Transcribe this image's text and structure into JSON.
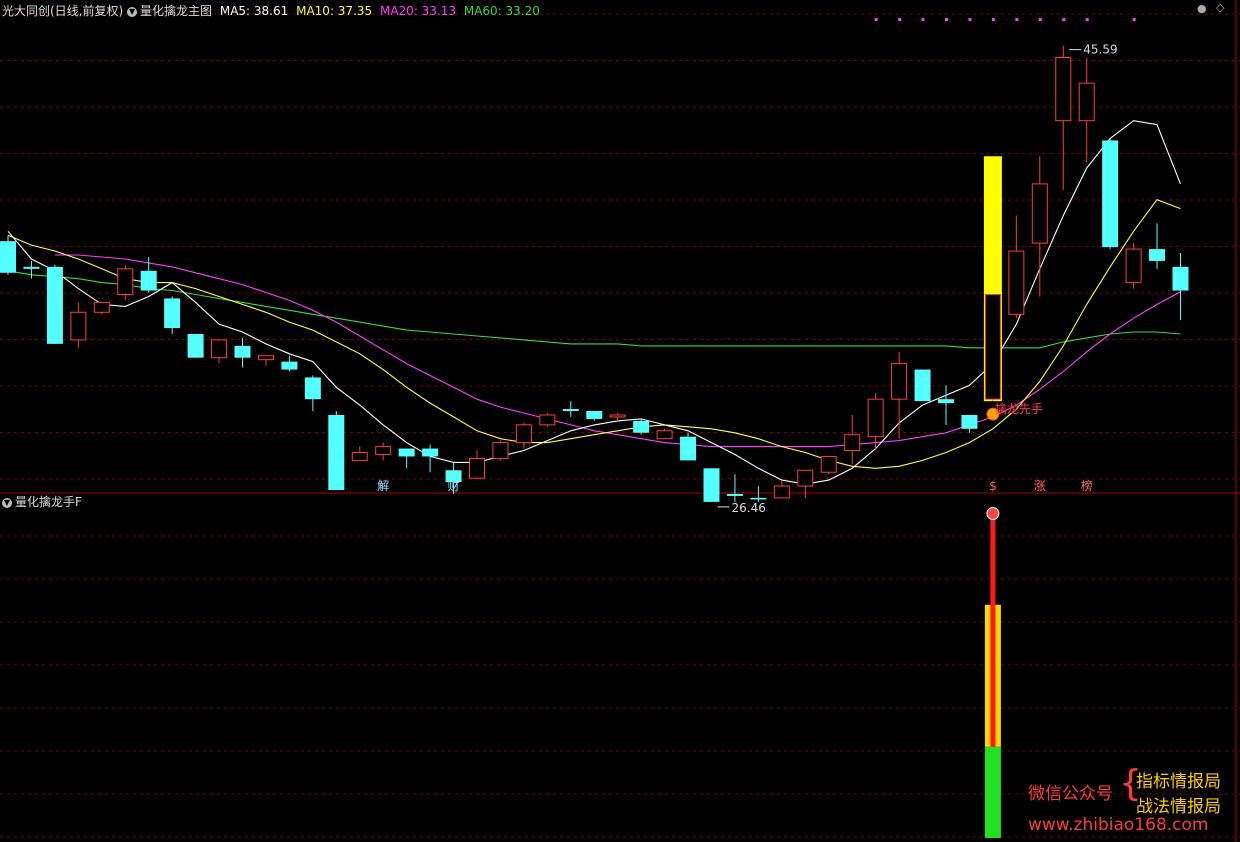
{
  "header": {
    "stock": "光大同创(日线,前复权)",
    "indicator": "量化擒龙主图",
    "ma5_label": "MA5: 38.61",
    "ma10_label": "MA10: 37.35",
    "ma20_label": "MA20: 33.13",
    "ma60_label": "MA60: 33.20"
  },
  "sub_header": {
    "title": "量化擒龙手F"
  },
  "colors": {
    "up": "#ff3c3c",
    "down": "#54ffff",
    "ma5": "#ffffff",
    "ma10": "#ffff4a",
    "ma20": "#ff3cff",
    "ma60": "#3cd93c",
    "grid": "#7a0000",
    "signal": "#ffff00"
  },
  "chart_data": {
    "type": "candlestick",
    "ylim": [
      23,
      47
    ],
    "candles": [
      {
        "o": 35.7,
        "h": 36.0,
        "c": 34.1,
        "l": 34.0,
        "d": "down"
      },
      {
        "o": 34.4,
        "h": 34.7,
        "c": 34.3,
        "l": 33.8,
        "d": "down"
      },
      {
        "o": 34.4,
        "h": 34.5,
        "c": 30.5,
        "l": 30.5,
        "d": "down"
      },
      {
        "o": 30.7,
        "h": 32.6,
        "c": 32.1,
        "l": 30.3,
        "d": "up"
      },
      {
        "o": 32.1,
        "h": 32.6,
        "c": 32.6,
        "l": 32.0,
        "d": "up"
      },
      {
        "o": 33.0,
        "h": 34.5,
        "c": 34.3,
        "l": 32.7,
        "d": "up"
      },
      {
        "o": 34.2,
        "h": 34.9,
        "c": 33.2,
        "l": 33.1,
        "d": "down"
      },
      {
        "o": 32.8,
        "h": 32.9,
        "c": 31.3,
        "l": 31.0,
        "d": "down"
      },
      {
        "o": 31.0,
        "h": 31.0,
        "c": 29.8,
        "l": 29.8,
        "d": "down"
      },
      {
        "o": 29.8,
        "h": 30.7,
        "c": 30.7,
        "l": 29.5,
        "d": "up"
      },
      {
        "o": 30.4,
        "h": 30.8,
        "c": 29.8,
        "l": 29.3,
        "d": "down"
      },
      {
        "o": 29.7,
        "h": 29.9,
        "c": 29.9,
        "l": 29.4,
        "d": "up"
      },
      {
        "o": 29.6,
        "h": 29.9,
        "c": 29.2,
        "l": 29.1,
        "d": "down"
      },
      {
        "o": 28.8,
        "h": 28.9,
        "c": 27.7,
        "l": 27.1,
        "d": "down"
      },
      {
        "o": 26.9,
        "h": 27.1,
        "c": 23.1,
        "l": 23.1,
        "d": "down"
      },
      {
        "o": 24.6,
        "h": 25.3,
        "c": 25.0,
        "l": 24.6,
        "d": "up"
      },
      {
        "o": 24.9,
        "h": 25.5,
        "c": 25.3,
        "l": 24.6,
        "d": "up"
      },
      {
        "o": 25.2,
        "h": 25.2,
        "c": 24.8,
        "l": 24.2,
        "d": "down"
      },
      {
        "o": 25.2,
        "h": 25.4,
        "c": 24.8,
        "l": 24.0,
        "d": "down"
      },
      {
        "o": 24.1,
        "h": 24.5,
        "c": 23.5,
        "l": 22.9,
        "d": "down"
      },
      {
        "o": 23.7,
        "h": 25.1,
        "c": 24.7,
        "l": 23.7,
        "d": "up"
      },
      {
        "o": 24.7,
        "h": 25.6,
        "c": 25.5,
        "l": 24.6,
        "d": "up"
      },
      {
        "o": 25.5,
        "h": 26.5,
        "c": 26.4,
        "l": 25.2,
        "d": "up"
      },
      {
        "o": 26.4,
        "h": 27.0,
        "c": 26.9,
        "l": 26.3,
        "d": "up"
      },
      {
        "o": 27.1,
        "h": 27.6,
        "c": 27.2,
        "l": 26.8,
        "d": "down"
      },
      {
        "o": 27.1,
        "h": 27.1,
        "c": 26.7,
        "l": 26.6,
        "d": "down"
      },
      {
        "o": 26.8,
        "h": 27.0,
        "c": 26.9,
        "l": 26.6,
        "d": "up"
      },
      {
        "o": 26.6,
        "h": 26.7,
        "c": 26.0,
        "l": 25.9,
        "d": "down"
      },
      {
        "o": 25.7,
        "h": 26.2,
        "c": 26.1,
        "l": 25.7,
        "d": "up"
      },
      {
        "o": 25.8,
        "h": 26.0,
        "c": 24.6,
        "l": 24.6,
        "d": "down"
      },
      {
        "o": 24.2,
        "h": 24.2,
        "c": 22.5,
        "l": 22.5,
        "d": "down"
      },
      {
        "o": 22.9,
        "h": 23.9,
        "c": 22.8,
        "l": 22.5,
        "d": "down"
      },
      {
        "o": 22.7,
        "h": 23.3,
        "c": 22.7,
        "l": 22.5,
        "d": "down"
      },
      {
        "o": 22.7,
        "h": 23.6,
        "c": 23.3,
        "l": 22.7,
        "d": "up"
      },
      {
        "o": 23.3,
        "h": 24.1,
        "c": 24.1,
        "l": 22.7,
        "d": "up"
      },
      {
        "o": 24.0,
        "h": 24.6,
        "c": 24.8,
        "l": 23.9,
        "d": "up"
      },
      {
        "o": 25.1,
        "h": 26.9,
        "c": 25.9,
        "l": 24.4,
        "d": "up"
      },
      {
        "o": 25.8,
        "h": 28.0,
        "c": 27.7,
        "l": 25.1,
        "d": "up"
      },
      {
        "o": 27.7,
        "h": 30.1,
        "c": 29.5,
        "l": 25.7,
        "d": "up"
      },
      {
        "o": 29.2,
        "h": 29.2,
        "c": 27.6,
        "l": 27.6,
        "d": "down"
      },
      {
        "o": 27.7,
        "h": 28.4,
        "c": 27.5,
        "l": 26.4,
        "d": "down"
      },
      {
        "o": 26.9,
        "h": 26.9,
        "c": 26.2,
        "l": 26.0,
        "d": "down"
      },
      {
        "o": 27.7,
        "h": 33.0,
        "c": 33.0,
        "l": 27.6,
        "d": "up"
      },
      {
        "o": 32.0,
        "h": 37.0,
        "c": 35.2,
        "l": 31.8,
        "d": "up"
      },
      {
        "o": 35.6,
        "h": 40.0,
        "c": 38.6,
        "l": 32.9,
        "d": "up"
      },
      {
        "o": 41.8,
        "h": 45.6,
        "c": 45.0,
        "l": 38.3,
        "d": "up"
      },
      {
        "o": 41.8,
        "h": 45.0,
        "c": 43.7,
        "l": 39.7,
        "d": "up"
      },
      {
        "o": 40.8,
        "h": 40.9,
        "c": 35.4,
        "l": 35.3,
        "d": "down"
      },
      {
        "o": 35.3,
        "h": 35.6,
        "c": 33.6,
        "l": 33.3,
        "d": "up"
      },
      {
        "o": 35.3,
        "h": 36.6,
        "c": 34.7,
        "l": 34.3,
        "d": "down"
      },
      {
        "o": 34.4,
        "h": 35.1,
        "c": 33.2,
        "l": 31.7,
        "d": "down"
      }
    ],
    "ma5": [
      36.2,
      34.8,
      34.2,
      33.3,
      32.5,
      32.4,
      32.9,
      33.6,
      32.6,
      31.5,
      31.1,
      30.5,
      30.0,
      29.6,
      28.3,
      27.4,
      26.4,
      25.5,
      24.8,
      24.5,
      24.5,
      24.8,
      25.1,
      25.6,
      26.1,
      26.4,
      26.6,
      26.7,
      26.4,
      26.1,
      25.5,
      24.9,
      24.2,
      23.6,
      23.4,
      23.6,
      24.2,
      25.2,
      26.5,
      27.4,
      27.9,
      28.4,
      29.5,
      31.5,
      34.3,
      37.0,
      39.4,
      40.9,
      41.8,
      41.6,
      38.6
    ],
    "ma10": [
      36.0,
      35.5,
      35.2,
      34.8,
      34.3,
      33.8,
      33.6,
      33.6,
      33.3,
      32.9,
      32.5,
      32.1,
      31.6,
      31.2,
      30.6,
      30.0,
      29.2,
      28.3,
      27.5,
      26.8,
      26.1,
      25.7,
      25.5,
      25.5,
      25.7,
      25.9,
      26.1,
      26.3,
      26.4,
      26.3,
      26.2,
      26.0,
      25.7,
      25.3,
      25.0,
      24.6,
      24.3,
      24.2,
      24.3,
      24.6,
      25.0,
      25.5,
      26.2,
      27.2,
      28.6,
      30.4,
      32.5,
      34.4,
      36.2,
      37.8,
      37.35
    ],
    "ma20": [
      null,
      null,
      35.0,
      35.0,
      34.9,
      34.8,
      34.6,
      34.4,
      34.1,
      33.8,
      33.5,
      33.1,
      32.7,
      32.2,
      31.6,
      30.9,
      30.2,
      29.5,
      28.9,
      28.3,
      27.7,
      27.3,
      27.0,
      26.7,
      26.4,
      26.1,
      25.9,
      25.7,
      25.5,
      25.4,
      25.3,
      25.3,
      25.3,
      25.3,
      25.3,
      25.3,
      25.4,
      25.5,
      25.6,
      25.8,
      26.0,
      26.4,
      26.8,
      27.4,
      28.2,
      29.1,
      30.1,
      31.0,
      31.8,
      32.5,
      33.13
    ],
    "ma60": [
      34.2,
      34.0,
      33.9,
      33.8,
      33.6,
      33.5,
      33.3,
      33.2,
      33.0,
      32.8,
      32.6,
      32.4,
      32.2,
      32.0,
      31.8,
      31.6,
      31.4,
      31.2,
      31.1,
      31.0,
      30.9,
      30.8,
      30.7,
      30.6,
      30.5,
      30.5,
      30.5,
      30.4,
      30.4,
      30.4,
      30.4,
      30.4,
      30.4,
      30.4,
      30.4,
      30.4,
      30.4,
      30.4,
      30.4,
      30.4,
      30.4,
      30.3,
      30.3,
      30.3,
      30.3,
      30.6,
      30.8,
      31.0,
      31.1,
      31.1,
      31.0
    ],
    "annotations": {
      "high": {
        "text": "45.59",
        "candle": 45
      },
      "low": {
        "text": "26.46",
        "candle": 30
      }
    },
    "signal_label": "擒龙先手",
    "markers": [
      {
        "text": "解",
        "candle": 16
      },
      {
        "text": "财",
        "candle": 19
      },
      {
        "text": "$",
        "candle": 42
      },
      {
        "text": "涨",
        "candle": 44
      },
      {
        "text": "榜",
        "candle": 46
      }
    ],
    "sub_bars": {
      "candle": 42,
      "green_level": 0.27,
      "yellow_top_level": 0.69,
      "red_top_level": 0.96
    }
  },
  "watermark": {
    "account": "微信公众号",
    "brace": "{",
    "line1": "指标情报局",
    "line2": "战法情报局",
    "url": "www.zhibiao168.com"
  },
  "icons": {
    "collapse": "collapse-icon",
    "menu": "menu-icon"
  }
}
